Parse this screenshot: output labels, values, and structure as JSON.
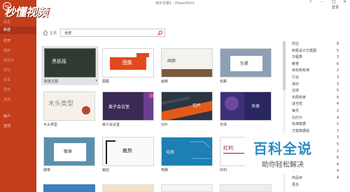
{
  "window": {
    "title": "演示文稿1 - PowerPoint",
    "sign_in": "登录"
  },
  "watermark_logo": "秒懂视频",
  "rail": {
    "items": [
      {
        "label": "信息",
        "state": "dim"
      },
      {
        "label": "新建",
        "state": "active"
      },
      {
        "label": "打开",
        "state": "normal"
      },
      {
        "label": "保存",
        "state": "dim"
      },
      {
        "label": "另存为",
        "state": "dim"
      },
      {
        "label": "打印",
        "state": "dim"
      },
      {
        "label": "共享",
        "state": "dim"
      },
      {
        "label": "导出",
        "state": "dim"
      },
      {
        "label": "关闭",
        "state": "dim"
      },
      {
        "label": "帐户",
        "state": "normal"
      },
      {
        "label": "选项",
        "state": "normal"
      }
    ]
  },
  "search": {
    "home_label": "主页",
    "value": "全部"
  },
  "templates": [
    {
      "label": "新建主题",
      "thumb_text": "黑板报",
      "style": "chalk",
      "selected": true
    },
    {
      "label": "图集",
      "thumb_text": "图集",
      "style": "red-banner"
    },
    {
      "label": "画廊",
      "thumb_text": "画廊",
      "style": "wood"
    },
    {
      "label": "包裹",
      "thumb_text": "包裹",
      "style": "parcel"
    },
    {
      "label": "木头类型",
      "thumb_text": "木头类型",
      "style": "woodtype"
    },
    {
      "label": "离子会议室",
      "thumb_text": "离子会议室",
      "style": "ion"
    },
    {
      "label": "切片",
      "thumb_text": "切片",
      "style": "slice"
    },
    {
      "label": "天体",
      "thumb_text": "天体",
      "style": "celestial"
    },
    {
      "label": "徽章",
      "thumb_text": "徽章",
      "style": "badge"
    },
    {
      "label": "裁剪",
      "thumb_text": "裁剪",
      "style": "crop"
    },
    {
      "label": "电路",
      "thumb_text": "电路",
      "style": "circuit"
    },
    {
      "label": "红利",
      "thumb_text": "红利",
      "style": "dividend"
    }
  ],
  "categories": [
    {
      "name": "商业",
      "count": "8"
    },
    {
      "name": "积极设计方案图",
      "count": "5"
    },
    {
      "name": "日程表",
      "count": "3"
    },
    {
      "name": "教育",
      "count": "6"
    },
    {
      "name": "目标和标准",
      "count": "2"
    },
    {
      "name": "行业",
      "count": "3"
    },
    {
      "name": "演示",
      "count": "3"
    },
    {
      "name": "业绩",
      "count": "5"
    },
    {
      "name": "布局构架",
      "count": "9"
    },
    {
      "name": "适当性",
      "count": "4"
    },
    {
      "name": "每页",
      "count": "2"
    },
    {
      "name": "幻灯片",
      "count": "4"
    },
    {
      "name": "标准数据",
      "count": "2"
    },
    {
      "name": "方案数据组",
      "count": "7"
    },
    {
      "name": "个人",
      "count": "3"
    },
    {
      "name": "图表",
      "count": "5"
    },
    {
      "name": "图片",
      "count": "2"
    },
    {
      "name": "报告",
      "count": "6"
    },
    {
      "name": "事件",
      "count": "4"
    },
    {
      "name": "4:3",
      "count": "4"
    },
    {
      "name": "商品目",
      "count": "4"
    },
    {
      "name": "更多",
      "count": ""
    }
  ],
  "overlay": {
    "title": "百科全说",
    "subtitle": "助你轻松解决"
  },
  "colors": {
    "rail": "#c43e1c",
    "accent": "#e24a1e",
    "overlay_blue": "#2b8cc4"
  }
}
